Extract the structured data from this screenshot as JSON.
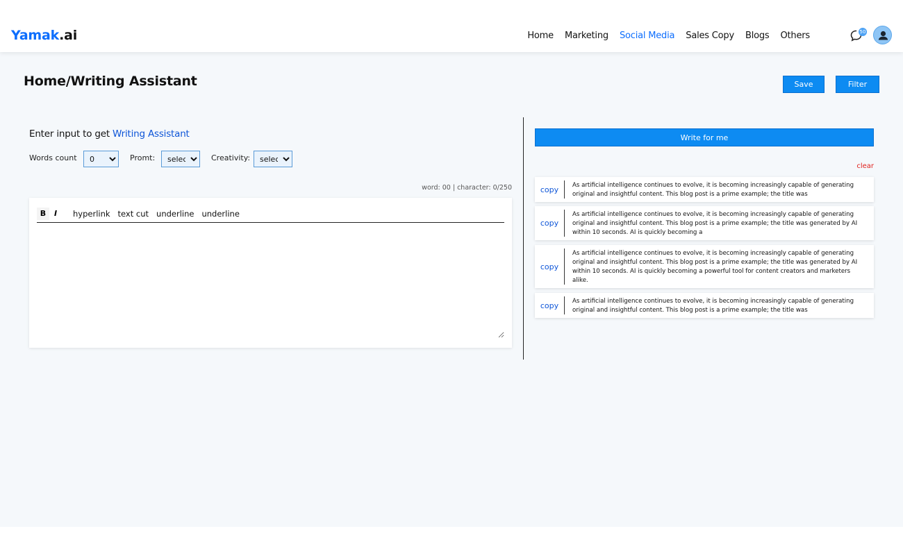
{
  "header": {
    "logo_brand": "Yamak",
    "logo_tld": ".ai",
    "nav": [
      {
        "label": "Home",
        "active": false
      },
      {
        "label": "Marketing",
        "active": false
      },
      {
        "label": "Social Media",
        "active": true
      },
      {
        "label": "Sales Copy",
        "active": false
      },
      {
        "label": "Blogs",
        "active": false
      },
      {
        "label": "Others",
        "active": false
      }
    ],
    "chat_badge": "50",
    "chat_icon": "chat-bubble-icon",
    "avatar_icon": "user-avatar-icon"
  },
  "page": {
    "title": "Home/Writing Assistant",
    "save_label": "Save",
    "filter_label": "Filter"
  },
  "input_panel": {
    "heading_prefix": "Enter input to get ",
    "heading_highlight": "Writing Assistant",
    "words_count_label": "Words count",
    "words_count_value": "0",
    "prompt_label": "Promt:",
    "prompt_value": "select",
    "creativity_label": "Creativity:",
    "creativity_value": "select",
    "counter": "word: 00 | character: 0/250",
    "toolbar": {
      "bold": "B",
      "italic": "I",
      "items": [
        "hyperlink",
        "text cut",
        "underline",
        "underline"
      ]
    }
  },
  "output_panel": {
    "write_label": "Write for me",
    "clear_label": "clear",
    "copy_label": "copy",
    "results": [
      "As artificial intelligence continues to evolve, it is becoming increasingly capable of generating original and insightful content. This blog post is a prime example; the title was",
      "As artificial intelligence continues to evolve, it is becoming increasingly capable of generating original and insightful content. This blog post is a prime example; the title was generated by AI within 10 seconds. AI is quickly becoming a",
      "As artificial intelligence continues to evolve, it is becoming increasingly capable of generating original and insightful content. This blog post is a prime example; the title was generated by AI within 10 seconds. AI is quickly becoming a powerful tool for content creators and marketers alike.",
      "As artificial intelligence continues to evolve, it is becoming increasingly capable of generating original and insightful content. This blog post is a prime example; the title was"
    ]
  },
  "colors": {
    "accent": "#0d8bf2",
    "link": "#0d55d8",
    "danger": "#e0211c",
    "background": "#f5f8fb"
  }
}
